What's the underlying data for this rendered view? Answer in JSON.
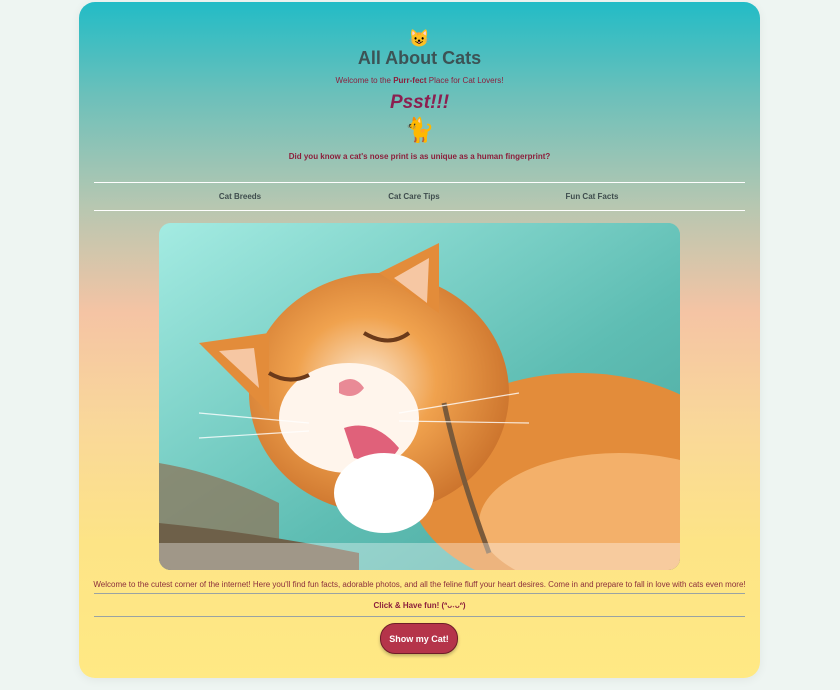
{
  "header": {
    "emoji_top": "😺",
    "title": "All About Cats",
    "welcome_prefix": "Welcome to the ",
    "welcome_bold": "Purr-fect",
    "welcome_suffix": " Place for Cat Lovers!",
    "psst": "Psst!!!",
    "emoji_mid": "🐈",
    "fact": "Did you know a cat's nose print is as unique as a human fingerprint?"
  },
  "nav": {
    "items": [
      "Cat Breeds",
      "Cat Care Tips",
      "Fun Cat Facts"
    ]
  },
  "photo": {
    "icon": "cat-photo"
  },
  "content": {
    "intro": "Welcome to the cutest corner of the internet! Here you'll find fun facts, adorable photos, and all the feline fluff your heart desires. Come in and prepare to fall in love with cats even more!",
    "click": "Click & Have fun! (ᐢᴗ˕ᴗᐢ)",
    "button": "Show my Cat!"
  },
  "colors": {
    "accent": "#b5344a",
    "text_red": "#8c1f3c",
    "title": "#3c5355"
  }
}
